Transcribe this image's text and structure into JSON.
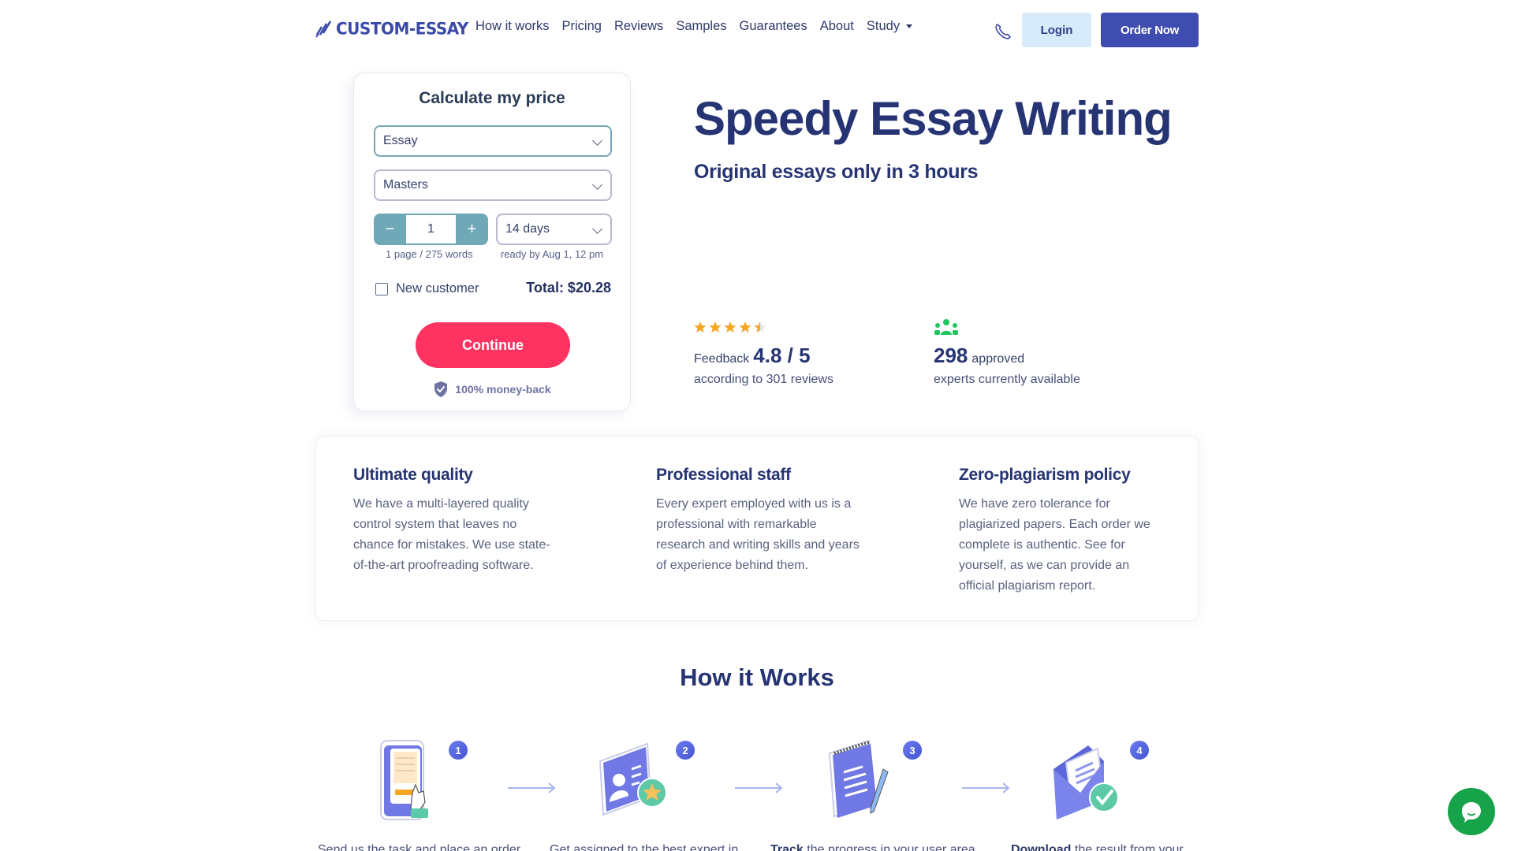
{
  "header": {
    "brand": "CUSTOM-ESSAY",
    "nav": [
      {
        "label": "How it works"
      },
      {
        "label": "Pricing"
      },
      {
        "label": "Reviews"
      },
      {
        "label": "Samples"
      },
      {
        "label": "Guarantees"
      },
      {
        "label": "About"
      },
      {
        "label": "Study",
        "has_dropdown": true
      }
    ],
    "phone_icon": "phone-icon",
    "login_label": "Login",
    "order_label": "Order Now"
  },
  "calculator": {
    "title": "Calculate my price",
    "paper_type": "Essay",
    "academic_level": "Masters",
    "pages_value": "1",
    "minus_label": "−",
    "plus_label": "+",
    "deadline": "14 days",
    "pages_hint": "1 page / 275 words",
    "ready_hint": "ready by Aug 1, 12 pm",
    "new_customer_label": "New customer",
    "new_customer_checked": false,
    "total": "Total: $20.28",
    "continue_label": "Continue",
    "moneyback_label": "100% money-back"
  },
  "hero": {
    "title": "Speedy Essay Writing",
    "subtitle": "Original essays only in 3 hours",
    "feedback": {
      "rating_stars": 4.5,
      "prefix": "Feedback",
      "score": "4.8 / 5",
      "sub": "according to 301 reviews"
    },
    "experts": {
      "count": "298",
      "suffix": "approved",
      "sub": "experts currently available"
    }
  },
  "features": [
    {
      "title": "Ultimate quality",
      "text": "We have a multi-layered quality control system that leaves no chance for mistakes. We use state-of-the-art proofreading software."
    },
    {
      "title": "Professional staff",
      "text": "Every expert employed with us is a professional with remarkable research and writing skills and years of experience behind them."
    },
    {
      "title": "Zero-plagiarism policy",
      "text": "We have zero tolerance for plagiarized papers. Each order we complete is authentic. See for yourself, as we can provide an official plagiarism report."
    }
  ],
  "how_it_works": {
    "title": "How it Works",
    "steps": [
      {
        "number": "1",
        "bold": "",
        "text": "Send us the task and place an order"
      },
      {
        "number": "2",
        "bold": "",
        "text": "Get assigned to the best expert in"
      },
      {
        "number": "3",
        "bold": "Track",
        "text": " the progress in your user area"
      },
      {
        "number": "4",
        "bold": "Download",
        "text": " the result from your"
      }
    ]
  },
  "colors": {
    "brand": "#3f4db0",
    "accent_cta": "#ff3361",
    "heading": "#263474",
    "star": "#f5a623",
    "experts_icon": "#22c55e",
    "chat": "#16a34a"
  }
}
